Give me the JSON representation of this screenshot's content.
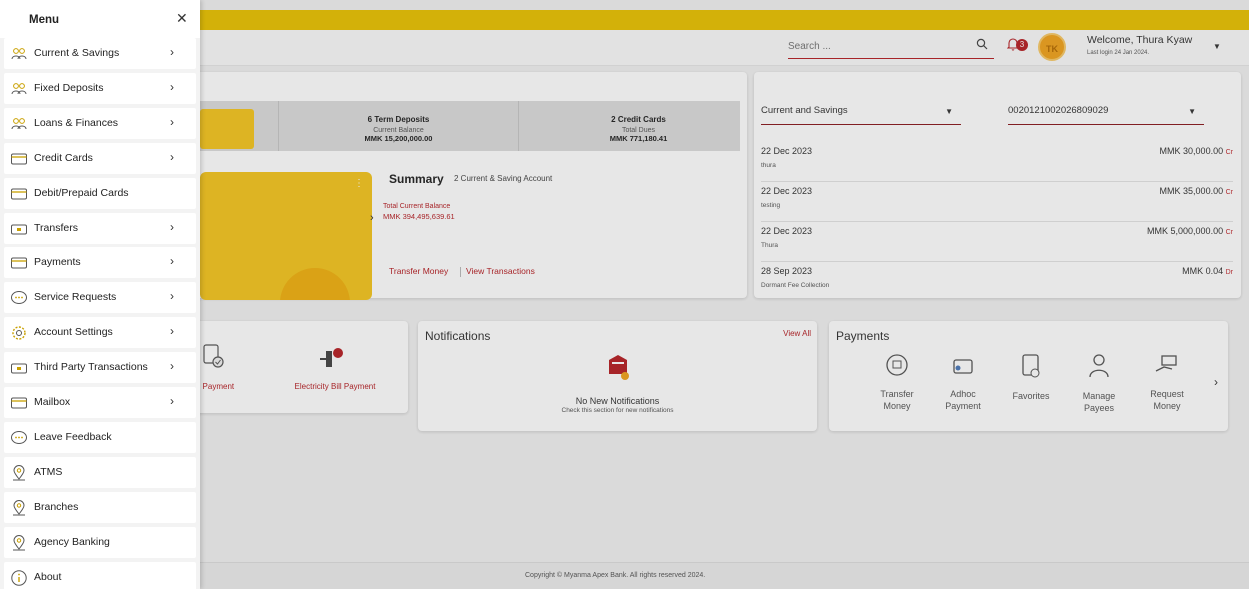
{
  "menu": {
    "title": "Menu",
    "close_symbol": "✕",
    "items": [
      {
        "label": "Current & Savings",
        "icon": "people-icon",
        "chevron": true
      },
      {
        "label": "Fixed Deposits",
        "icon": "people-icon",
        "chevron": true
      },
      {
        "label": "Loans & Finances",
        "icon": "people-icon",
        "chevron": true
      },
      {
        "label": "Credit Cards",
        "icon": "card-icon",
        "chevron": true
      },
      {
        "label": "Debit/Prepaid Cards",
        "icon": "card-icon",
        "chevron": false
      },
      {
        "label": "Transfers",
        "icon": "wallet-icon",
        "chevron": true
      },
      {
        "label": "Payments",
        "icon": "card-icon",
        "chevron": true
      },
      {
        "label": "Service Requests",
        "icon": "chat-icon",
        "chevron": true
      },
      {
        "label": "Account Settings",
        "icon": "gear-icon",
        "chevron": true
      },
      {
        "label": "Third Party Transactions",
        "icon": "wallet-icon",
        "chevron": true
      },
      {
        "label": "Mailbox",
        "icon": "card-icon",
        "chevron": true
      },
      {
        "label": "Leave Feedback",
        "icon": "chat-icon",
        "chevron": false
      },
      {
        "label": "ATMS",
        "icon": "location-icon",
        "chevron": false
      },
      {
        "label": "Branches",
        "icon": "location-icon",
        "chevron": false
      },
      {
        "label": "Agency Banking",
        "icon": "location-icon",
        "chevron": false
      },
      {
        "label": "About",
        "icon": "info-icon",
        "chevron": false
      }
    ]
  },
  "header": {
    "search_placeholder": "Search ...",
    "notification_count": "3",
    "avatar_initials": "TK",
    "welcome": "Welcome, Thura Kyaw",
    "last_login": "Last login 24 Jan 2024."
  },
  "summary": {
    "tiles": [
      {
        "title": "6 Term Deposits",
        "label": "Current Balance",
        "amount": "MMK 15,200,000.00"
      },
      {
        "title": "2 Credit Cards",
        "label": "Total Dues",
        "amount": "MMK 771,180.41"
      }
    ],
    "title": "Summary",
    "subtitle": "2 Current & Saving Account",
    "total_label": "Total Current Balance",
    "total_value": "MMK 394,495,639.61",
    "link_transfer": "Transfer Money",
    "link_view": "View Transactions"
  },
  "transactions": {
    "account_type": "Current and Savings",
    "account_number": "0020121002026809029",
    "rows": [
      {
        "date": "22 Dec 2023",
        "desc": "thura",
        "amount": "MMK 30,000.00",
        "type": "Cr"
      },
      {
        "date": "22 Dec 2023",
        "desc": "testing",
        "amount": "MMK 35,000.00",
        "type": "Cr"
      },
      {
        "date": "22 Dec 2023",
        "desc": "Thura",
        "amount": "MMK 5,000,000.00",
        "type": "Cr"
      },
      {
        "date": "28 Sep 2023",
        "desc": "Dormant Fee Collection",
        "amount": "MMK 0.04",
        "type": "Dr"
      }
    ]
  },
  "bill_payments": {
    "items": [
      "e Payment",
      "Electricity Bill Payment"
    ]
  },
  "notifications": {
    "title": "Notifications",
    "view_all": "View All",
    "empty_title": "No New Notifications",
    "empty_sub": "Check this section for new notifications"
  },
  "payments": {
    "title": "Payments",
    "items": [
      {
        "line1": "Transfer",
        "line2": "Money",
        "icon": "transfer-icon"
      },
      {
        "line1": "Adhoc",
        "line2": "Payment",
        "icon": "wallet-icon"
      },
      {
        "line1": "Favorites",
        "line2": "",
        "icon": "favorites-icon"
      },
      {
        "line1": "Manage",
        "line2": "Payees",
        "icon": "payee-icon"
      },
      {
        "line1": "Request",
        "line2": "Money",
        "icon": "request-money-icon"
      }
    ],
    "next_symbol": "›"
  },
  "footer": {
    "copyright": "Copyright © Myanma Apex Bank. All rights reserved 2024."
  },
  "colors": {
    "brand_gold": "#e8c200",
    "brand_red": "#b61f24"
  }
}
